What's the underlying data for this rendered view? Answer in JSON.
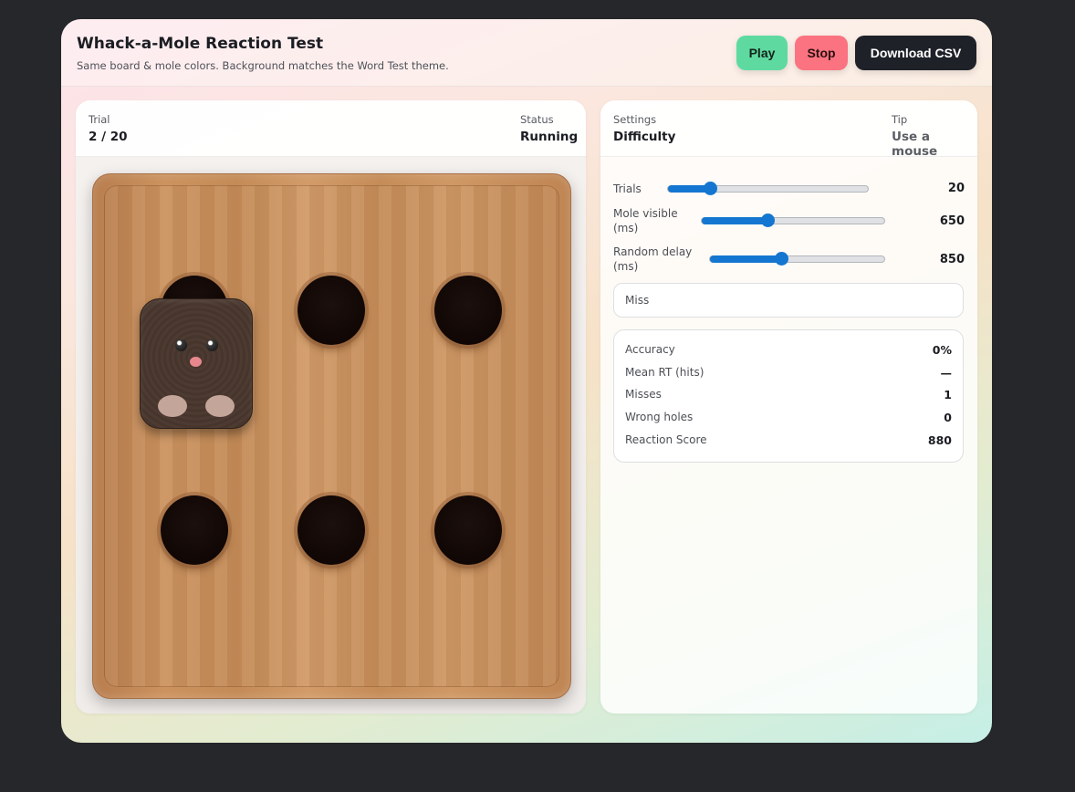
{
  "header": {
    "title": "Whack-a-Mole Reaction Test",
    "subtitle": "Same board & mole colors. Background matches the Word Test theme.",
    "play_label": "Play",
    "stop_label": "Stop",
    "csv_label": "Download CSV"
  },
  "game_panel": {
    "trial_label": "Trial",
    "trial_value": "2 / 20",
    "status_label": "Status",
    "status_value": "Running",
    "holes": 6,
    "active_hole": 1
  },
  "settings_panel": {
    "settings_label": "Settings",
    "settings_value": "Difficulty",
    "tip_label": "Tip",
    "tip_value": "Use a mouse",
    "sliders": [
      {
        "label": "Trials",
        "value": "20",
        "fraction": 0.21
      },
      {
        "label": "Mole visible (ms)",
        "value": "650",
        "fraction": 0.36
      },
      {
        "label": "Random delay (ms)",
        "value": "850",
        "fraction": 0.41
      }
    ],
    "feedback": "Miss",
    "stats": [
      {
        "label": "Accuracy",
        "value": "0%"
      },
      {
        "label": "Mean RT (hits)",
        "value": "—"
      },
      {
        "label": "Misses",
        "value": "1"
      },
      {
        "label": "Wrong holes",
        "value": "0"
      },
      {
        "label": "Reaction Score",
        "value": "880"
      }
    ]
  },
  "colors": {
    "play": "#5edaa0",
    "stop": "#fb7380",
    "csv": "#1e2128",
    "slider": "#1476d1"
  }
}
